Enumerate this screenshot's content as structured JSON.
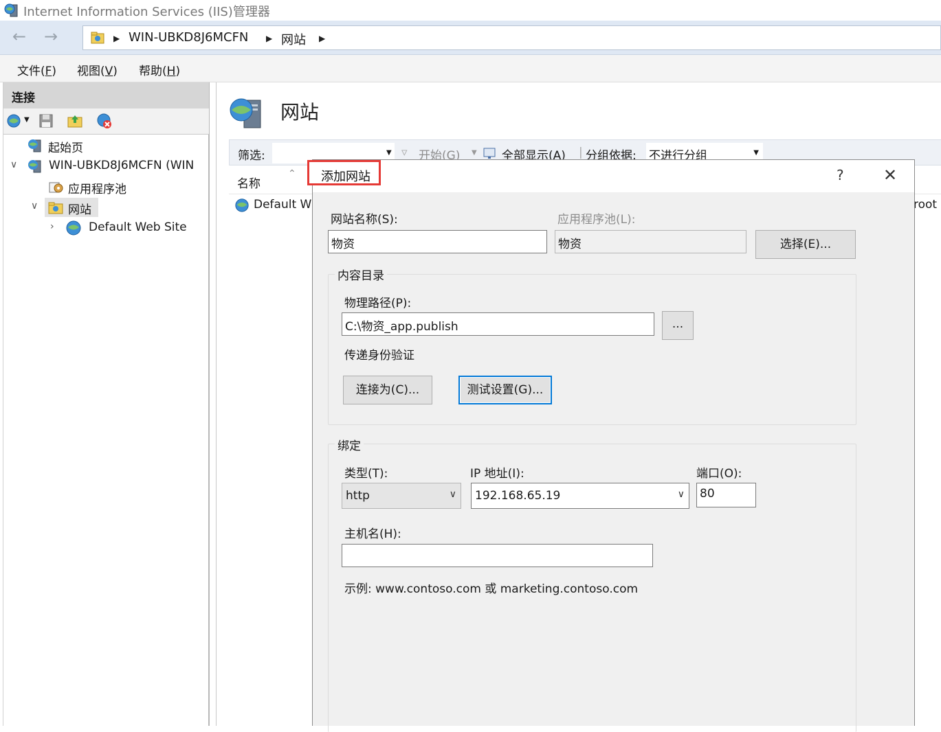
{
  "window": {
    "title": "Internet Information Services (IIS)管理器"
  },
  "address": {
    "crumbs": [
      "WIN-UBKD8J6MCFN",
      "网站"
    ]
  },
  "menu": {
    "file": "文件(F)",
    "file_base": "文件(",
    "file_key": "F",
    "view_base": "视图(",
    "view_key": "V",
    "help_base": "帮助(",
    "help_key": "H",
    "close_paren": ")"
  },
  "connections": {
    "header": "连接",
    "tree": [
      {
        "label": "起始页"
      },
      {
        "label": "WIN-UBKD8J6MCFN (WIN"
      },
      {
        "label": "应用程序池"
      },
      {
        "label": "网站"
      },
      {
        "label": "Default Web Site"
      }
    ]
  },
  "main": {
    "title": "网站",
    "filter_label": "筛选:",
    "start_label": "开始(G)",
    "show_all_label": "全部显示(A)",
    "group_by_label": "分组依据:",
    "group_by_value": "不进行分组",
    "col_name": "名称",
    "row_default": "Default W",
    "row_root": "root"
  },
  "dialog": {
    "title": "添加网站",
    "help": "?",
    "close": "✕",
    "site_name_label": "网站名称(S):",
    "site_name_value": "物资",
    "app_pool_label": "应用程序池(L):",
    "app_pool_value": "物资",
    "select_button": "选择(E)...",
    "content_dir_legend": "内容目录",
    "physical_path_label": "物理路径(P):",
    "physical_path_value": "C:\\物资_app.publish",
    "browse_button": "...",
    "pass_auth_label": "传递身份验证",
    "connect_as_button": "连接为(C)...",
    "test_settings_button": "测试设置(G)...",
    "binding_legend": "绑定",
    "type_label": "类型(T):",
    "type_value": "http",
    "ip_label": "IP 地址(I):",
    "ip_value": "192.168.65.19",
    "port_label": "端口(O):",
    "port_value": "80",
    "hostname_label": "主机名(H):",
    "hostname_value": "",
    "example_text": "示例: www.contoso.com 或 marketing.contoso.com"
  }
}
